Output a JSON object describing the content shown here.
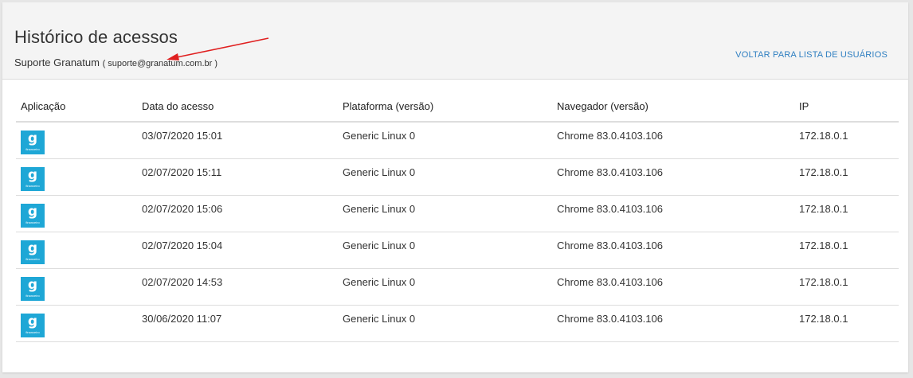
{
  "header": {
    "title": "Histórico de acessos",
    "user_name": "Suporte Granatum",
    "user_email": "( suporte@granatum.com.br )",
    "back_link": "VOLTAR PARA LISTA DE USUÁRIOS"
  },
  "table": {
    "columns": [
      "Aplicação",
      "Data do acesso",
      "Plataforma (versão)",
      "Navegador (versão)",
      "IP"
    ],
    "rows": [
      {
        "app_icon": "g",
        "app_icon_label": "financeiro",
        "date": "03/07/2020 15:01",
        "platform": "Generic Linux 0",
        "browser": "Chrome 83.0.4103.106",
        "ip": "172.18.0.1"
      },
      {
        "app_icon": "g",
        "app_icon_label": "financeiro",
        "date": "02/07/2020 15:11",
        "platform": "Generic Linux 0",
        "browser": "Chrome 83.0.4103.106",
        "ip": "172.18.0.1"
      },
      {
        "app_icon": "g",
        "app_icon_label": "financeiro",
        "date": "02/07/2020 15:06",
        "platform": "Generic Linux 0",
        "browser": "Chrome 83.0.4103.106",
        "ip": "172.18.0.1"
      },
      {
        "app_icon": "g",
        "app_icon_label": "financeiro",
        "date": "02/07/2020 15:04",
        "platform": "Generic Linux 0",
        "browser": "Chrome 83.0.4103.106",
        "ip": "172.18.0.1"
      },
      {
        "app_icon": "g",
        "app_icon_label": "financeiro",
        "date": "02/07/2020 14:53",
        "platform": "Generic Linux 0",
        "browser": "Chrome 83.0.4103.106",
        "ip": "172.18.0.1"
      },
      {
        "app_icon": "g",
        "app_icon_label": "financeiro",
        "date": "30/06/2020 11:07",
        "platform": "Generic Linux 0",
        "browser": "Chrome 83.0.4103.106",
        "ip": "172.18.0.1"
      }
    ]
  },
  "colors": {
    "link": "#2f7fc1",
    "app_icon_bg": "#1ea7d6",
    "annotation_arrow": "#e02020"
  }
}
